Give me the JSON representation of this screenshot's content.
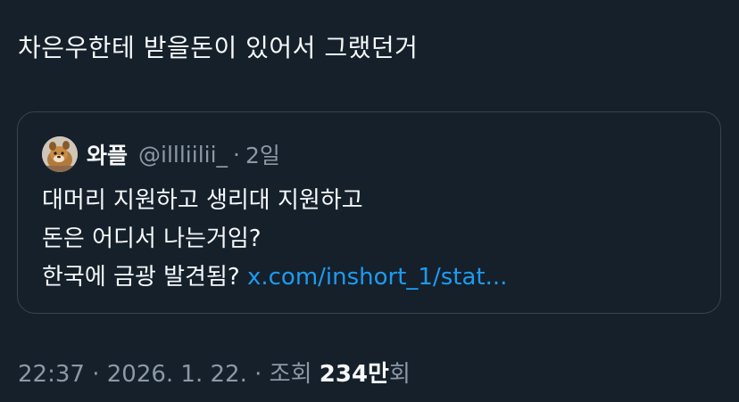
{
  "tweet": {
    "text": "차은우한테 받을돈이 있어서 그랬던거"
  },
  "quote": {
    "avatar_icon": "avatar-character-icon",
    "author_name": "와플",
    "author_handle": "@illliilii_",
    "separator": "·",
    "time": "2일",
    "lines": [
      "대머리 지원하고 생리대 지원하고",
      "돈은 어디서 나는거임?",
      "한국에 금광 발견됨? "
    ],
    "link_text": "x.com/inshort_1/stat..."
  },
  "meta": {
    "time": "22:37",
    "sep1": " · ",
    "date": "2026. 1. 22.",
    "sep2": " · ",
    "views_label": "조회 ",
    "views_count": "234만",
    "views_suffix": "회"
  },
  "colors": {
    "background": "#15202b",
    "text": "#f7f9f9",
    "secondary": "#8b98a5",
    "link": "#1d9bf0",
    "border": "#38444d"
  }
}
